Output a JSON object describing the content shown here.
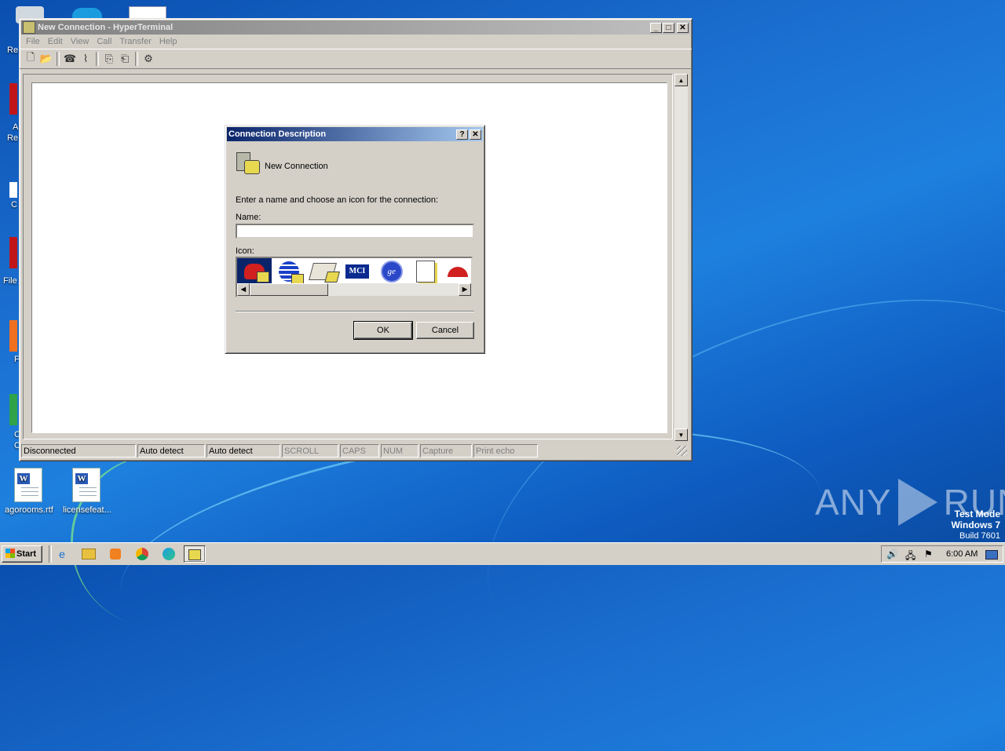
{
  "desktop": {
    "icons": [
      {
        "label": "agorooms.rtf"
      },
      {
        "label": "licensefeat..."
      }
    ],
    "left_fragments": [
      "Re",
      "A",
      "Re",
      "C",
      "File",
      "F",
      "C",
      "C"
    ],
    "watermark": {
      "brand": "ANY",
      "brand2": "RUN",
      "line1": "Test Mode",
      "line2": "Windows 7",
      "line3": "Build 7601"
    }
  },
  "hyperterminal": {
    "title": "New Connection - HyperTerminal",
    "menu": [
      "File",
      "Edit",
      "View",
      "Call",
      "Transfer",
      "Help"
    ],
    "status": [
      "Disconnected",
      "Auto detect",
      "Auto detect",
      "SCROLL",
      "CAPS",
      "NUM",
      "Capture",
      "Print echo"
    ]
  },
  "dialog": {
    "title": "Connection Description",
    "help_glyph": "?",
    "close_glyph": "✕",
    "heading": "New Connection",
    "instruction": "Enter a name and choose an icon for the connection:",
    "name_label": "Name:",
    "name_value": "",
    "icon_label": "Icon:",
    "icons": [
      "phone-icon",
      "globe-phone-icon",
      "fax-icon",
      "mci-icon",
      "ge-icon",
      "document-phone-icon",
      "umbrella-icon"
    ],
    "mci_text": "MCI",
    "ok_label": "OK",
    "cancel_label": "Cancel"
  },
  "taskbar": {
    "start_label": "Start",
    "clock": "6:00 AM"
  }
}
